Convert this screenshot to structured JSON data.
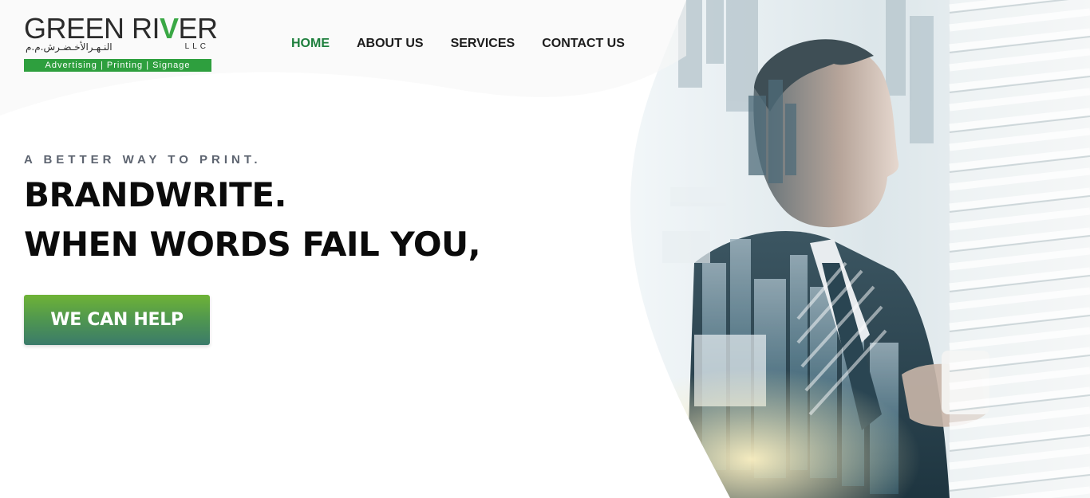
{
  "logo": {
    "name_part1": "GREEN RI",
    "name_v": "V",
    "name_part2": "ER",
    "llc": "LLC",
    "arabic": "النـهـرالأخـضـرش.م.م",
    "strip": "Advertising | Printing | Signage",
    "colors": {
      "brand_green": "#2e9f3e",
      "text": "#2b2b2b"
    }
  },
  "nav": {
    "items": [
      {
        "label": "HOME",
        "active": true
      },
      {
        "label": "ABOUT US",
        "active": false
      },
      {
        "label": "SERVICES",
        "active": false
      },
      {
        "label": "CONTACT US",
        "active": false
      }
    ],
    "active_color": "#1e7f3d"
  },
  "hero": {
    "tagline": "A BETTER WAY TO PRINT.",
    "headline_line1": "BRANDWRITE.",
    "headline_line2": "WHEN WORDS FAIL YOU,",
    "cta_label": "WE CAN HELP",
    "cta_colors": {
      "top": "#6fb336",
      "bottom": "#3b7b6a"
    },
    "image": "businessman-double-exposure-city-skyline-window-blinds"
  }
}
